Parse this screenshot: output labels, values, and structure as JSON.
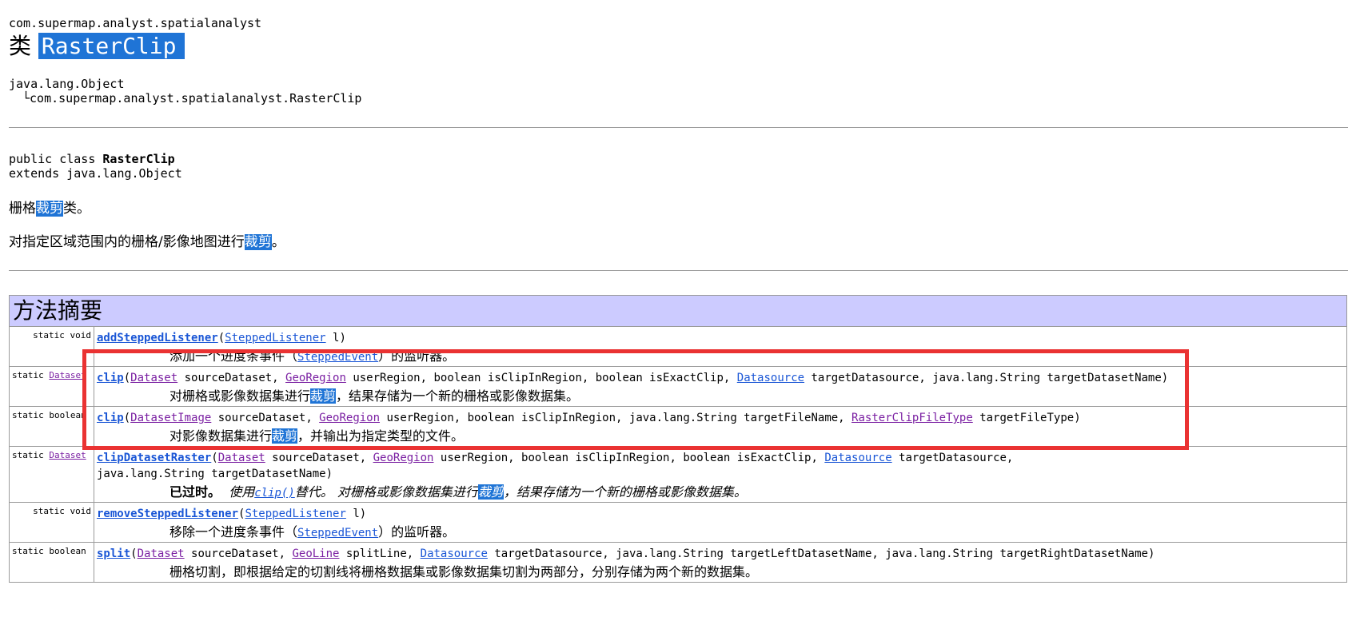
{
  "header": {
    "package": "com.supermap.analyst.spatialanalyst",
    "class_prefix": "类",
    "class_name": "RasterClip",
    "inherit_root": "java.lang.Object",
    "inherit_marker": "└",
    "inherit_child": "com.supermap.analyst.spatialanalyst.RasterClip"
  },
  "declaration": {
    "line1_prefix": "public class ",
    "line1_name": "RasterClip",
    "line2": "extends java.lang.Object"
  },
  "description": {
    "line1_a": "栅格",
    "line1_hl": "裁剪",
    "line1_b": "类。",
    "line2_a": "对指定区域范围内的栅格/影像地图进行",
    "line2_hl": "裁剪",
    "line2_b": "。"
  },
  "summary": {
    "title": "方法摘要",
    "rows": [
      {
        "mod_text": "static void",
        "name": "addSteppedListener",
        "params_html_parts": [
          "(",
          "SteppedListener",
          " l)"
        ],
        "desc_a": "添加一个进度条事件（",
        "desc_link": "SteppedEvent",
        "desc_b": "）的监听器。"
      },
      {
        "mod_static": "static ",
        "mod_link": "Dataset",
        "name": "clip",
        "p1": "Dataset",
        "p1t": " sourceDataset, ",
        "p2": "GeoRegion",
        "p2t": " userRegion, boolean isClipInRegion, boolean isExactClip, ",
        "p3": "Datasource",
        "p3t": " targetDatasource, java.lang.String targetDatasetName)",
        "desc_a": "对栅格或影像数据集进行",
        "desc_hl": "裁剪",
        "desc_b": "，结果存储为一个新的栅格或影像数据集。"
      },
      {
        "mod_text": "static boolean",
        "name": "clip",
        "p1": "DatasetImage",
        "p1t": " sourceDataset, ",
        "p2": "GeoRegion",
        "p2t": " userRegion, boolean isClipInRegion, java.lang.String targetFileName, ",
        "p3": "RasterClipFileType",
        "p3t": " targetFileType)",
        "desc_a": "对影像数据集进行",
        "desc_hl": "裁剪",
        "desc_b": "，并输出为指定类型的文件。"
      },
      {
        "mod_static": "static ",
        "mod_link": "Dataset",
        "name": "clipDatasetRaster",
        "p1": "Dataset",
        "p1t": " sourceDataset, ",
        "p2": "GeoRegion",
        "p2t": " userRegion, boolean isClipInRegion, boolean isExactClip, ",
        "p3": "Datasource",
        "p3t": " targetDatasource,",
        "line2": "java.lang.String targetDatasetName)",
        "deprecated": "已过时。",
        "desc_a": "使用",
        "desc_link": "clip()",
        "desc_b": "替代。 对栅格或影像数据集进行",
        "desc_hl": "裁剪",
        "desc_c": "，结果存储为一个新的栅格或影像数据集。"
      },
      {
        "mod_text": "static void",
        "name": "removeSteppedListener",
        "params_html_parts": [
          "(",
          "SteppedListener",
          " l)"
        ],
        "desc_a": "移除一个进度条事件（",
        "desc_link": "SteppedEvent",
        "desc_b": "）的监听器。"
      },
      {
        "mod_text": "static boolean",
        "name": "split",
        "p1": "Dataset",
        "p1t": " sourceDataset, ",
        "p2": "GeoLine",
        "p2t": " splitLine, ",
        "p3": "Datasource",
        "p3t": " targetDatasource, java.lang.String targetLeftDatasetName, java.lang.String targetRightDatasetName)",
        "desc_a": "栅格切割，即根据给定的切割线将栅格数据集或影像数据集切割为两部分，分别存储为两个新的数据集。"
      }
    ]
  },
  "colors": {
    "link": "#1a56d6",
    "visited_link": "#7a1fa2",
    "highlight": "#1f74d6",
    "table_header": "#cccbff",
    "annotation_box": "#ea3232"
  }
}
